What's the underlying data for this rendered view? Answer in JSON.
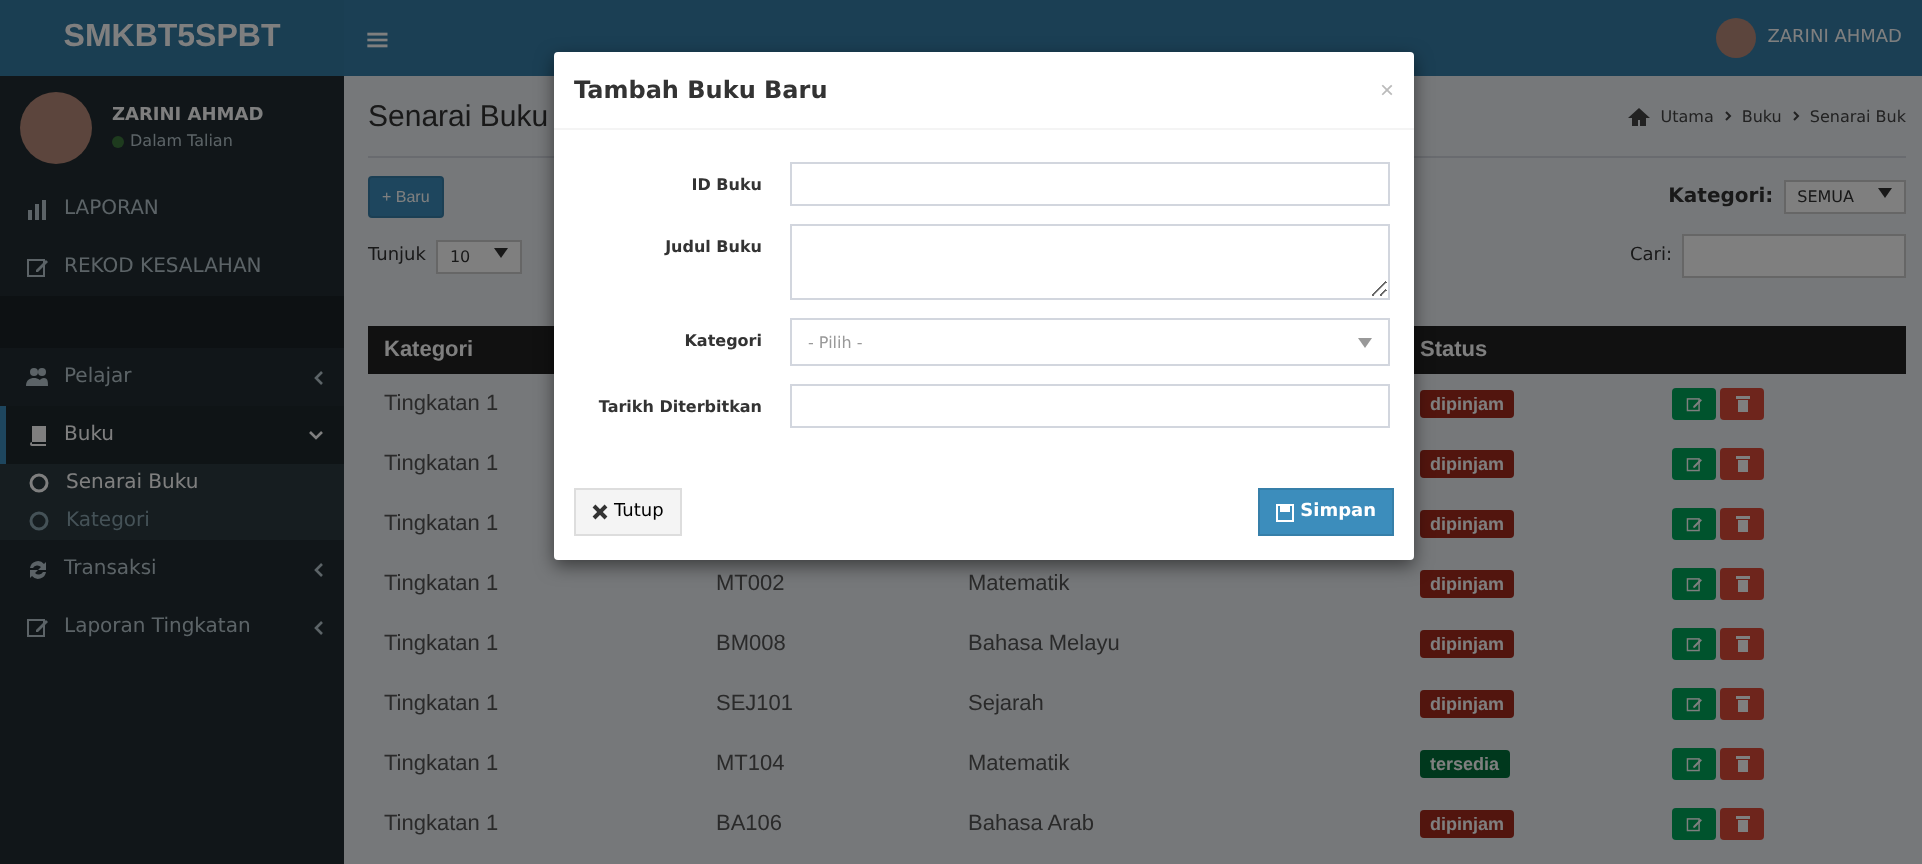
{
  "header": {
    "logo": "SMKBT5SPBT",
    "menu_icon": "≡",
    "user": "ZARINI AHMAD"
  },
  "sidebar": {
    "user": {
      "name": "ZARINI AHMAD",
      "status": "Dalam Talian"
    },
    "items": [
      {
        "label": "LAPORAN",
        "kind": "link",
        "selected": false
      },
      {
        "label": "REKOD KESALAHAN",
        "kind": "link",
        "selected": false
      },
      {
        "label": "Pelajar",
        "kind": "tree",
        "selected": false,
        "expanded": false
      },
      {
        "label": "Buku",
        "kind": "tree",
        "selected": true,
        "expanded": true,
        "children": [
          {
            "label": "Senarai Buku",
            "selected": true
          },
          {
            "label": "Kategori",
            "selected": false
          }
        ]
      },
      {
        "label": "Transaksi",
        "kind": "tree",
        "selected": false,
        "expanded": false
      },
      {
        "label": "Laporan Tingkatan",
        "kind": "tree",
        "selected": false,
        "expanded": false
      }
    ]
  },
  "page": {
    "title": "Senarai Buku",
    "breadcrumb": [
      "Utama",
      "Buku",
      "Senarai Buk"
    ],
    "new_button": "+ Baru",
    "show_label": "Tunjuk",
    "show_value": "10",
    "category_label": "Kategori:",
    "category_value": "SEMUA",
    "search_label": "Cari:"
  },
  "table": {
    "columns": [
      "Kategori",
      "",
      "",
      "Status",
      ""
    ],
    "rows": [
      {
        "category": "Tingkatan 1",
        "status": "dipinjam",
        "kind": "borrowed"
      },
      {
        "category": "Tingkatan 1",
        "status": "dipinjam",
        "kind": "borrowed"
      },
      {
        "category": "Tingkatan 1",
        "status": "dipinjam",
        "kind": "borrowed"
      },
      {
        "category": "Tingkatan 1",
        "id": "MT002",
        "title": "Matematik",
        "status": "dipinjam",
        "kind": "borrowed"
      },
      {
        "category": "Tingkatan 1",
        "id": "BM008",
        "title": "Bahasa Melayu",
        "status": "dipinjam",
        "kind": "borrowed"
      },
      {
        "category": "Tingkatan 1",
        "id": "SEJ101",
        "title": "Sejarah",
        "status": "dipinjam",
        "kind": "borrowed"
      },
      {
        "category": "Tingkatan 1",
        "id": "MT104",
        "title": "Matematik",
        "status": "tersedia",
        "kind": "available"
      },
      {
        "category": "Tingkatan 1",
        "id": "BA106",
        "title": "Bahasa Arab",
        "status": "dipinjam",
        "kind": "borrowed"
      }
    ]
  },
  "modal": {
    "title": "Tambah Buku Baru",
    "close": "×",
    "fields": [
      {
        "label": "ID Buku",
        "kind": "text"
      },
      {
        "label": "Judul Buku",
        "kind": "textarea"
      },
      {
        "label": "Kategori",
        "kind": "select",
        "placeholder": "- Pilih -"
      },
      {
        "label": "Tarikh Diterbitkan",
        "kind": "text"
      }
    ],
    "close_button": "Tutup",
    "save_button": "Simpan"
  }
}
